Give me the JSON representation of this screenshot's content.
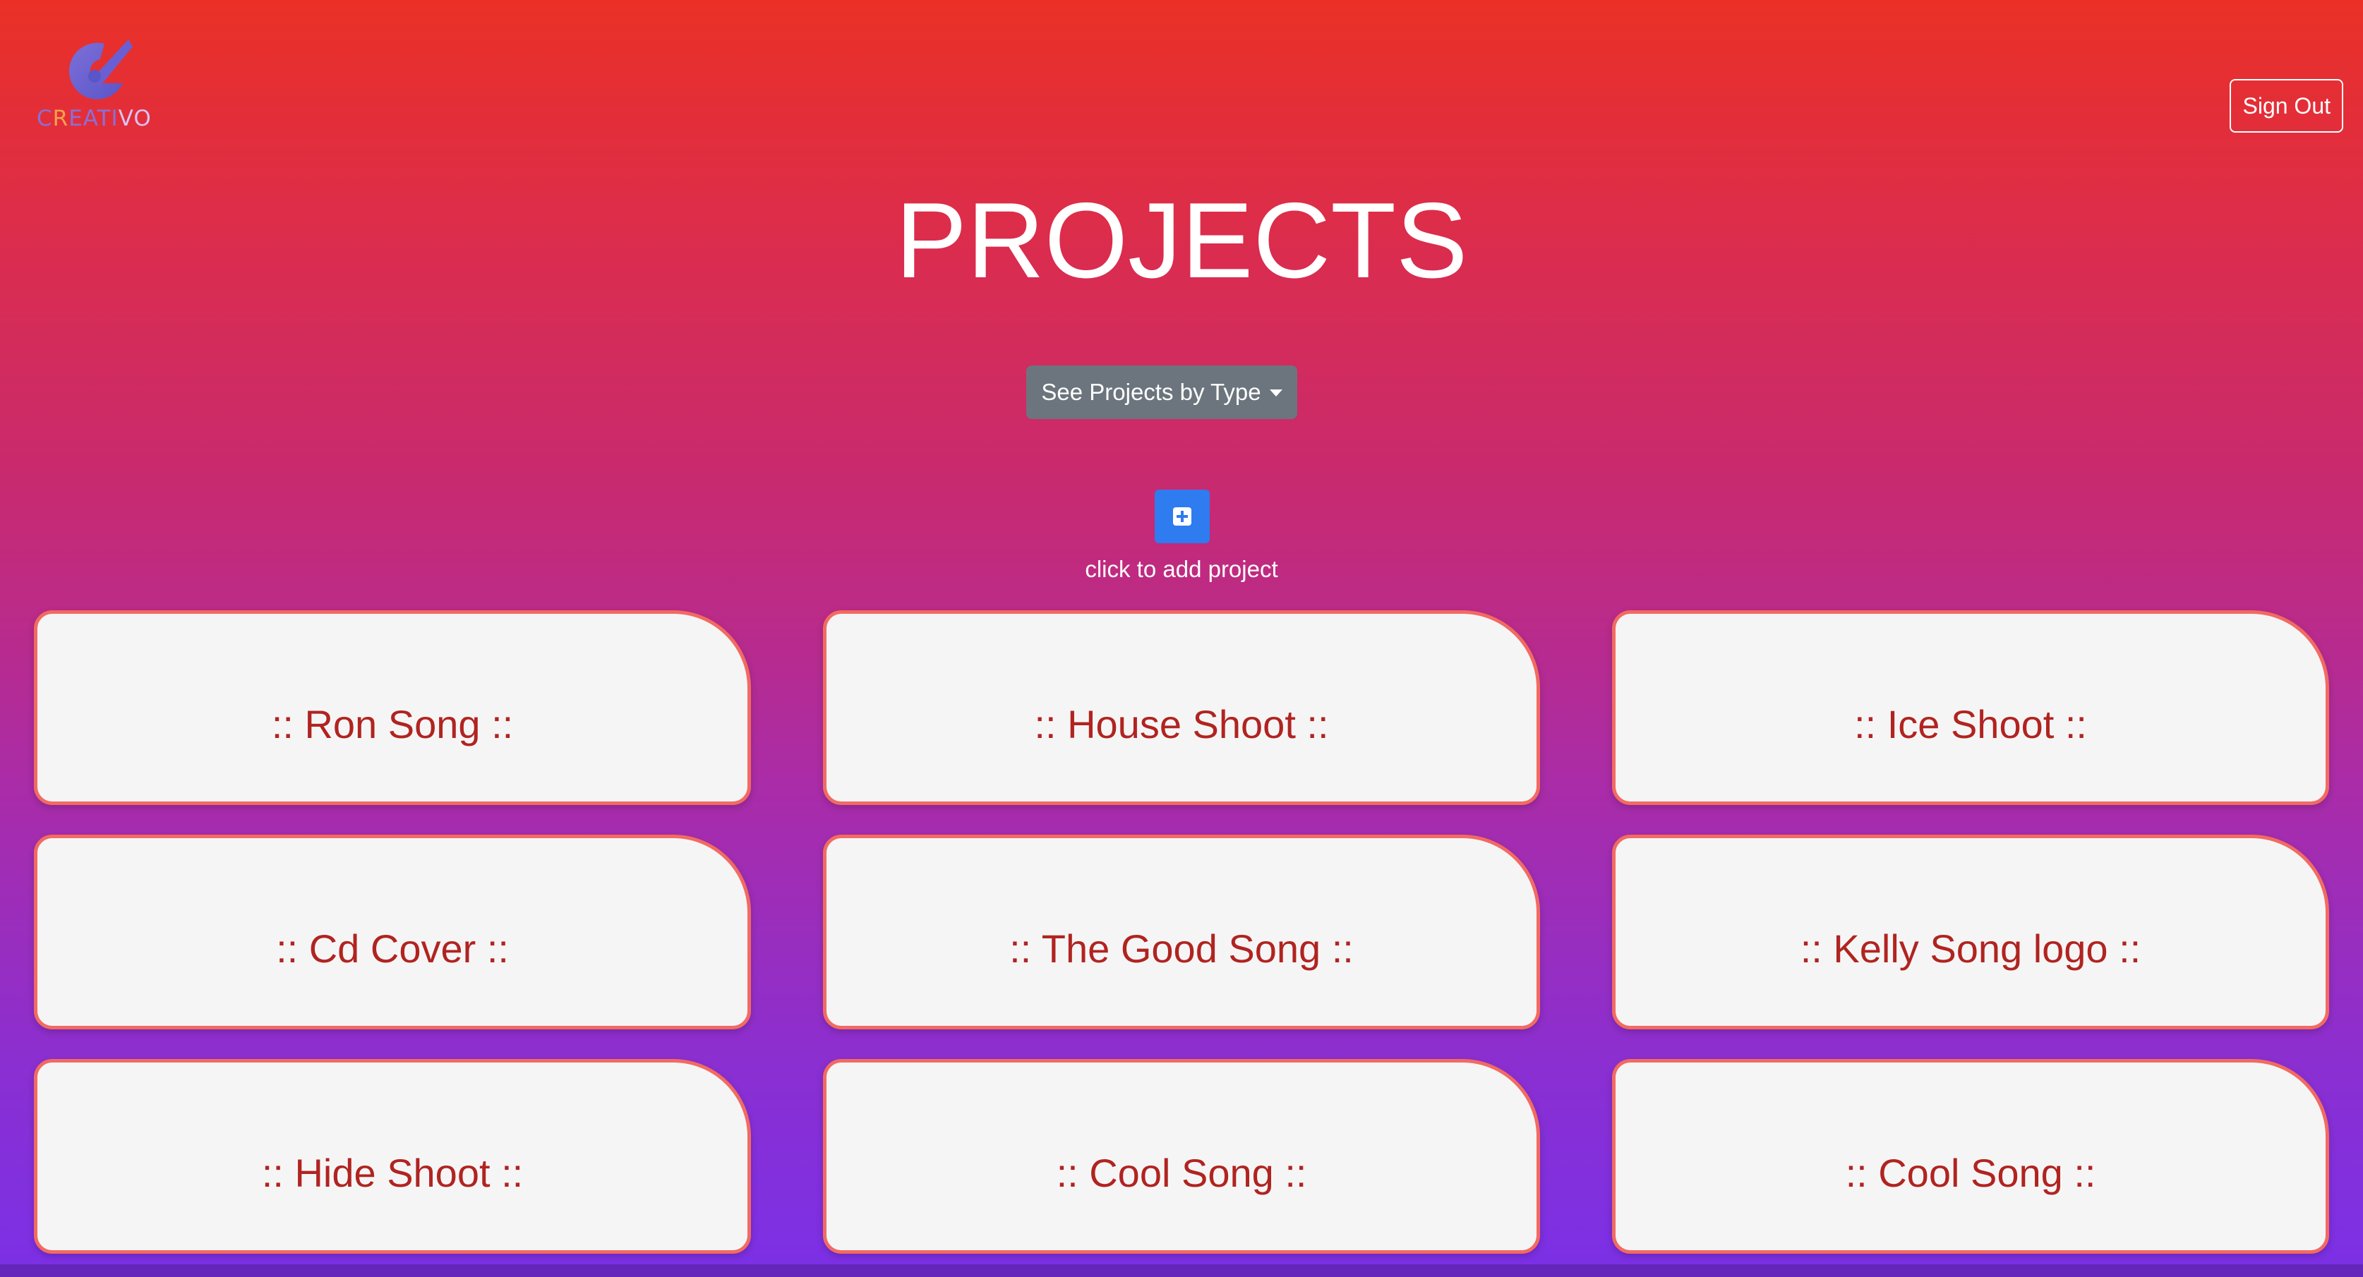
{
  "header": {
    "logo_text_prefix": "C",
    "logo_text_e": "R",
    "logo_text_rest": "EATI",
    "logo_text_tail": "VO",
    "sign_out_label": "Sign Out"
  },
  "page": {
    "title": "PROJECTS",
    "type_dropdown_label": "See Projects by Type",
    "add_caption": "click to add project"
  },
  "projects": [
    {
      "label": ":: Ron Song ::"
    },
    {
      "label": ":: House Shoot ::"
    },
    {
      "label": ":: Ice Shoot ::"
    },
    {
      "label": ":: Cd Cover ::"
    },
    {
      "label": ":: The Good Song ::"
    },
    {
      "label": ":: Kelly Song logo ::"
    },
    {
      "label": ":: Hide Shoot ::"
    },
    {
      "label": ":: Cool Song ::"
    },
    {
      "label": ":: Cool Song ::"
    }
  ],
  "colors": {
    "gradient_top": "#ea3026",
    "gradient_bottom": "#7b30e6",
    "card_border": "#f26a62",
    "card_text": "#b02420",
    "add_button": "#2f7bf0",
    "dropdown": "#6c757d"
  },
  "icons": {
    "logo": "creativo-logo-icon",
    "add": "plus-square-icon",
    "dropdown": "caret-down-icon"
  }
}
